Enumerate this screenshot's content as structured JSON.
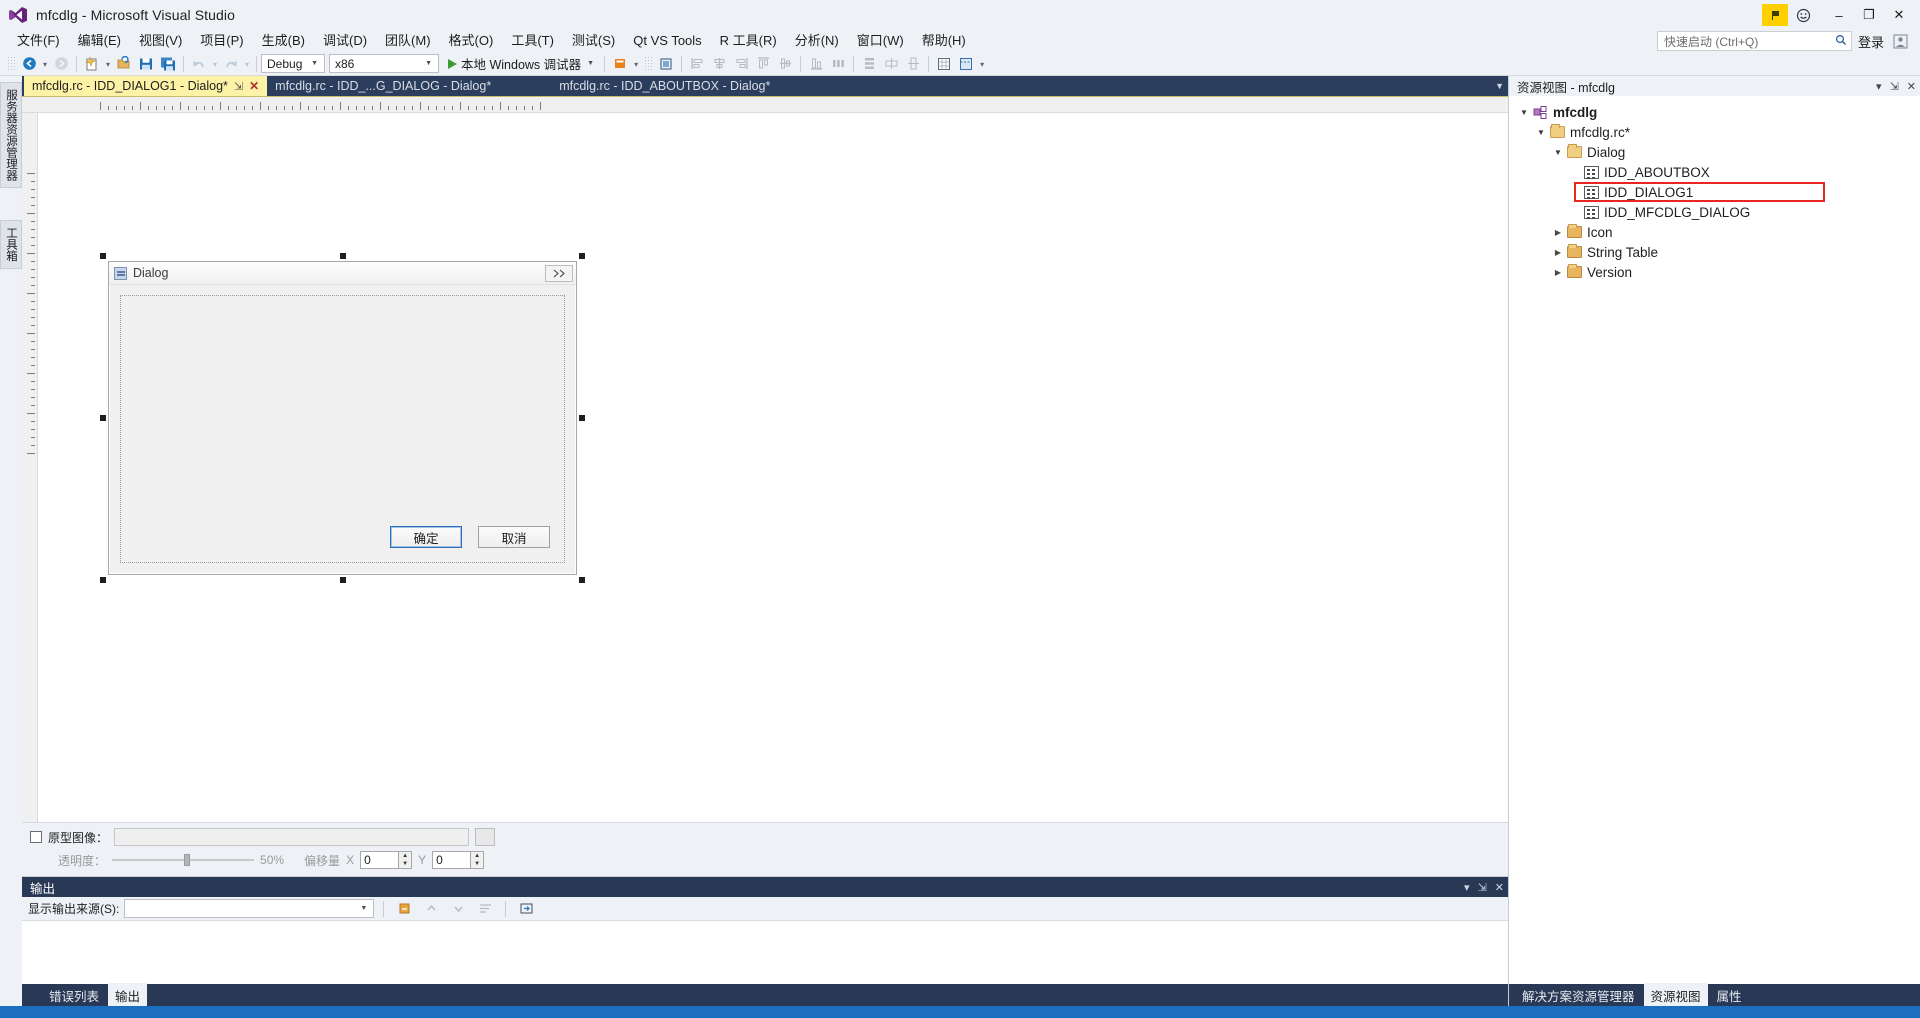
{
  "window": {
    "title": "mfcdlg - Microsoft Visual Studio",
    "logo_icon": "visual-studio-logo-icon",
    "notification_icon": "notification-flag-icon",
    "feedback_icon": "feedback-smiley-icon",
    "minimize_label": "–",
    "maximize_label": "❐",
    "close_label": "✕",
    "accent_color": "#293955",
    "highlight_color": "#ffd000"
  },
  "menubar": {
    "items": [
      {
        "label": "文件(F)"
      },
      {
        "label": "编辑(E)"
      },
      {
        "label": "视图(V)"
      },
      {
        "label": "项目(P)"
      },
      {
        "label": "生成(B)"
      },
      {
        "label": "调试(D)"
      },
      {
        "label": "团队(M)"
      },
      {
        "label": "格式(O)"
      },
      {
        "label": "工具(T)"
      },
      {
        "label": "测试(S)"
      },
      {
        "label": "Qt VS Tools"
      },
      {
        "label": "R 工具(R)"
      },
      {
        "label": "分析(N)"
      },
      {
        "label": "窗口(W)"
      },
      {
        "label": "帮助(H)"
      }
    ],
    "quick_launch_placeholder": "快速启动 (Ctrl+Q)",
    "quick_launch_value": "",
    "quick_launch_icon": "magnifier-icon",
    "signin_label": "登录",
    "signin_icon": "user-account-icon"
  },
  "toolbar": {
    "back_icon": "navigate-back-icon",
    "forward_icon": "navigate-forward-icon",
    "new_project_icon": "new-project-icon",
    "open_icon": "open-file-icon",
    "save_icon": "save-icon",
    "save_all_icon": "save-all-icon",
    "undo_icon": "undo-icon",
    "redo_icon": "redo-icon",
    "config_value": "Debug",
    "platform_value": "x86",
    "run_label": "本地 Windows 调试器",
    "run_icon": "play-triangle-icon",
    "highlight_icon": "highlight-icon",
    "step_icon": "step-icon",
    "align_left_icon": "align-left-icon",
    "align_center_icon": "align-center-icon",
    "align_right_icon": "align-right-icon",
    "align_top_icon": "align-top-icon",
    "align_middle_icon": "align-middle-icon",
    "align_bottom_icon": "align-bottom-icon",
    "space_across_icon": "space-across-icon",
    "space_down_icon": "space-down-icon",
    "grid_icon": "toggle-grid-icon",
    "guides_icon": "toggle-guides-icon"
  },
  "document_tabs": [
    {
      "label": "mfcdlg.rc - IDD_DIALOG1 - Dialog*",
      "active": true,
      "pin_icon": "pin-icon",
      "close_icon": "close-tab-icon"
    },
    {
      "label": "mfcdlg.rc - IDD_...G_DIALOG - Dialog*",
      "active": false
    },
    {
      "label": "mfcdlg.rc - IDD_ABOUTBOX - Dialog*",
      "active": false
    }
  ],
  "left_strips": {
    "top_tab": "服务器资源管理器",
    "bottom_tab": "工具箱"
  },
  "designer": {
    "dialog": {
      "title": "Dialog",
      "icon": "dialog-window-icon",
      "close_button_label": "✕",
      "buttons": [
        {
          "label": "确定",
          "name": "ok"
        },
        {
          "label": "取消",
          "name": "cancel"
        }
      ]
    },
    "options": {
      "prototype_label": "原型图像：",
      "prototype_value": "",
      "prototype_checked": false,
      "browse_label": "...",
      "opacity_label": "透明度：",
      "opacity_value": "50%",
      "offset_label": "偏移量",
      "offset_x_label": "X",
      "offset_x_value": "0",
      "offset_y_label": "Y",
      "offset_y_value": "0"
    }
  },
  "output_pane": {
    "title": "输出",
    "dropdown_icon": "chevron-down-icon",
    "pin_icon": "pin-icon",
    "close_icon": "close-icon",
    "source_label": "显示输出来源(S):",
    "source_value": "",
    "clear_icon": "clear-output-icon",
    "find_prev_icon": "find-prev-icon",
    "find_next_icon": "find-next-icon",
    "wrap_icon": "word-wrap-icon",
    "goto_icon": "goto-icon",
    "body_text": ""
  },
  "bottom_tabs": [
    {
      "label": "错误列表",
      "active": false
    },
    {
      "label": "输出",
      "active": true
    }
  ],
  "right_panel": {
    "title_main": "资源视图",
    "title_sep": " - ",
    "title_sub": "mfcdlg",
    "dropdown_icon": "chevron-down-icon",
    "pin_icon": "pin-icon",
    "close_icon": "close-icon",
    "tree": [
      {
        "label": "mfcdlg",
        "depth": 0,
        "icon": "project-icon",
        "twisty": "expanded",
        "bold": true,
        "selected": false
      },
      {
        "label": "mfcdlg.rc*",
        "depth": 1,
        "icon": "folder-open-icon",
        "twisty": "expanded",
        "bold": false,
        "selected": false
      },
      {
        "label": "Dialog",
        "depth": 2,
        "icon": "folder-open-icon",
        "twisty": "expanded",
        "bold": false,
        "selected": false
      },
      {
        "label": "IDD_ABOUTBOX",
        "depth": 3,
        "icon": "resource-icon",
        "twisty": "none",
        "bold": false,
        "selected": false
      },
      {
        "label": "IDD_DIALOG1",
        "depth": 3,
        "icon": "resource-icon",
        "twisty": "none",
        "bold": false,
        "selected": true
      },
      {
        "label": "IDD_MFCDLG_DIALOG",
        "depth": 3,
        "icon": "resource-icon",
        "twisty": "none",
        "bold": false,
        "selected": false
      },
      {
        "label": "Icon",
        "depth": 2,
        "icon": "folder-closed-icon",
        "twisty": "collapsed",
        "bold": false,
        "selected": false
      },
      {
        "label": "String Table",
        "depth": 2,
        "icon": "folder-closed-icon",
        "twisty": "collapsed",
        "bold": false,
        "selected": false
      },
      {
        "label": "Version",
        "depth": 2,
        "icon": "folder-closed-icon",
        "twisty": "collapsed",
        "bold": false,
        "selected": false
      }
    ],
    "selection_color": "#e8281e",
    "footer_tabs": [
      {
        "label": "解决方案资源管理器",
        "active": false
      },
      {
        "label": "资源视图",
        "active": true
      },
      {
        "label": "属性",
        "active": false
      }
    ]
  }
}
